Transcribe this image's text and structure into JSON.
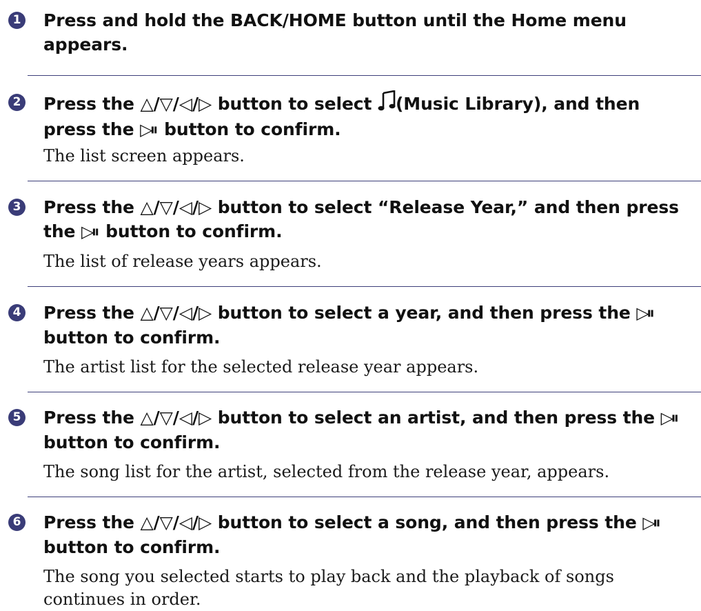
{
  "glyphs": {
    "up": "△",
    "down": "▽",
    "left": "◁",
    "right": "▷",
    "slash": "/",
    "play_pause": "▷⏸"
  },
  "steps": [
    {
      "number": "1",
      "head_text": "Press and hold the BACK/HOME button until the Home menu appears.",
      "desc": ""
    },
    {
      "number": "2",
      "head_pre": "Press the ",
      "head_mid": " button to select ",
      "head_icon_label": "(Music Library), and then press the ",
      "head_end": " button to confirm.",
      "desc": "The list screen appears."
    },
    {
      "number": "3",
      "head_pre": "Press the ",
      "head_mid": " button to select “Release Year,” and then press the ",
      "head_end": " button to confirm.",
      "desc": "The list of release years appears."
    },
    {
      "number": "4",
      "head_pre": "Press the ",
      "head_mid": " button to select a year, and then press the ",
      "head_end": " button to confirm.",
      "desc": "The artist list for the selected release year appears."
    },
    {
      "number": "5",
      "head_pre": "Press the ",
      "head_mid": " button to select an artist, and then press the ",
      "head_end": " button to confirm.",
      "desc": "The song list for the artist, selected from the release year, appears."
    },
    {
      "number": "6",
      "head_pre": "Press the ",
      "head_mid": " button to select a song, and then press the ",
      "head_end": " button to confirm.",
      "desc": "The song you selected starts to play back and the playback of songs continues in order."
    }
  ]
}
